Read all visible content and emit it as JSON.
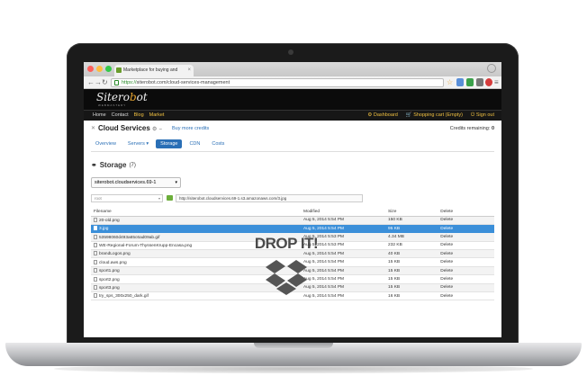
{
  "browser": {
    "tab_title": "Marketplace for buying and",
    "url_scheme": "https://",
    "url_rest": "siterobot.com/cloud-services-management"
  },
  "site": {
    "logo_pre": "Sitero",
    "logo_o": "b",
    "logo_post": "ot",
    "tagline": "WEBMASTERY",
    "nav_left": [
      "Home",
      "Contact",
      "Blog",
      "Market"
    ],
    "dashboard": "Dashboard",
    "cart": "Shopping cart (Empty)",
    "signout": "Sign out"
  },
  "page": {
    "title": "Cloud Services",
    "buy_credits": "Buy more credits",
    "credits_label": "Credits remaining:",
    "credits_value": "0",
    "tabs": [
      "Overview",
      "Servers ▾",
      "Storage",
      "CDN",
      "Costs"
    ],
    "active_tab": "Storage",
    "section_title": "Storage",
    "section_count": "(7)",
    "bucket": "siterobot.cloudservices.69-1",
    "root_select": "root",
    "s3_url": "http://siterobot.cloudservices.69-1.s3.amazonaws.com/3.jpg"
  },
  "table": {
    "headers": [
      "Filename",
      "Modified",
      "Size",
      "Delete"
    ],
    "rows": [
      {
        "name": "20-old.png",
        "modified": "Aug 5, 2014 5:54 PM",
        "size": "150 KB",
        "delete": "Delete"
      },
      {
        "name": "3.jpg",
        "modified": "Aug 5, 2014 5:54 PM",
        "size": "95 KB",
        "delete": "Delete"
      },
      {
        "name": "53598060d493a65c6ad09ab.gif",
        "modified": "Aug 5, 2014 5:53 PM",
        "size": "4.34 MB",
        "delete": "Delete"
      },
      {
        "name": "WE-Regional-Forum-ThyssenKrupp-Encasa.png",
        "modified": "Aug 5, 2014 5:53 PM",
        "size": "232 KB",
        "delete": "Delete"
      },
      {
        "name": "brandLogos.png",
        "modified": "Aug 5, 2014 5:54 PM",
        "size": "40 KB",
        "delete": "Delete"
      },
      {
        "name": "cloud.aws.png",
        "modified": "Aug 5, 2014 5:54 PM",
        "size": "15 KB",
        "delete": "Delete"
      },
      {
        "name": "sport1.png",
        "modified": "Aug 5, 2014 5:54 PM",
        "size": "15 KB",
        "delete": "Delete"
      },
      {
        "name": "sport2.png",
        "modified": "Aug 5, 2014 5:54 PM",
        "size": "15 KB",
        "delete": "Delete"
      },
      {
        "name": "sport3.png",
        "modified": "Aug 5, 2014 5:54 PM",
        "size": "15 KB",
        "delete": "Delete"
      },
      {
        "name": "try_sps_300x250_dark.gif",
        "modified": "Aug 5, 2014 5:54 PM",
        "size": "16 KB",
        "delete": "Delete"
      }
    ],
    "selected_index": 1
  },
  "overlay": {
    "drop_text": "DROP IT!",
    "icon": "dropbox-icon"
  },
  "colors": {
    "accent": "#2a6fb6",
    "selected_row": "#3b8fd9",
    "header_bg": "#0b0b0b",
    "nav_highlight": "#f0c040"
  }
}
